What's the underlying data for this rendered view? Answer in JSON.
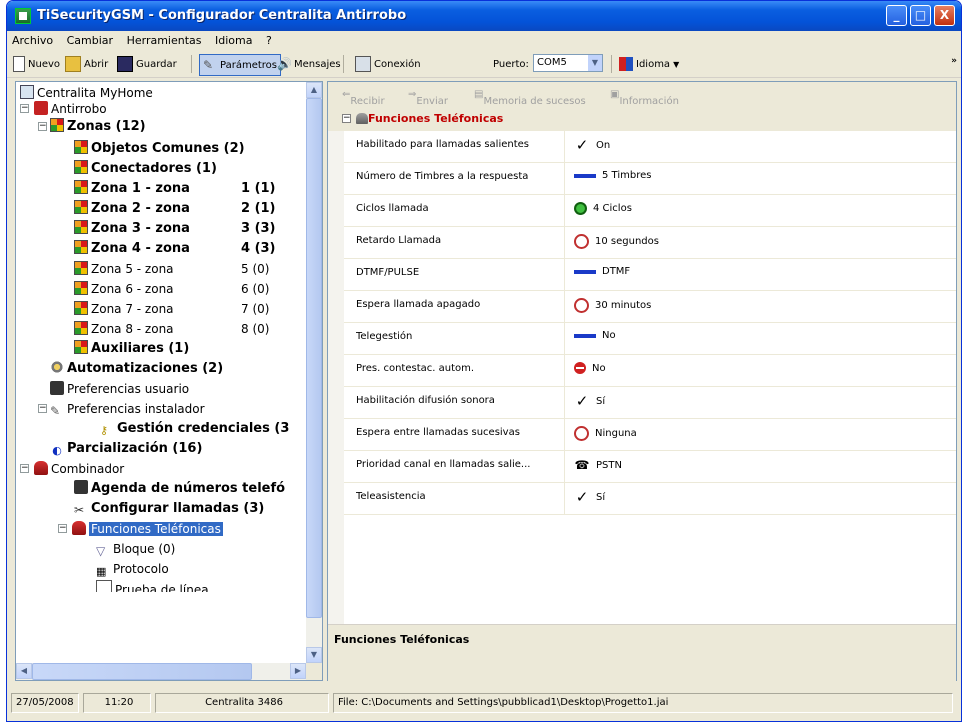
{
  "window": {
    "title": "TiSecurityGSM - Configurador Centralita Antirrobo",
    "controls": [
      "_",
      "□",
      "X"
    ]
  },
  "menu": [
    "Archivo",
    "Cambiar",
    "Herramientas",
    "Idioma",
    "?"
  ],
  "toolbar": {
    "nuevo": "Nuevo",
    "abrir": "Abrir",
    "guardar": "Guardar",
    "parametros": "Parámetros",
    "mensajes": "Mensajes",
    "conexion": "Conexión",
    "puerto_label": "Puerto:",
    "puerto_value": "COM5",
    "idioma": "Idioma",
    "more": "»"
  },
  "tree": {
    "root": "Centralita MyHome",
    "antirrobo": "Antirrobo",
    "zonas": "Zonas (12)",
    "objetos_comunes": "Objetos Comunes (2)",
    "conectadores": "Conectadores (1)",
    "zonas_list": [
      {
        "name": "Zona 1 - zona",
        "count": "1 (1)",
        "bold": true
      },
      {
        "name": "Zona 2 - zona",
        "count": "2 (1)",
        "bold": true
      },
      {
        "name": "Zona 3 - zona",
        "count": "3 (3)",
        "bold": true
      },
      {
        "name": "Zona 4 - zona",
        "count": "4 (3)",
        "bold": true
      },
      {
        "name": "Zona 5 - zona",
        "count": "5 (0)",
        "bold": false
      },
      {
        "name": "Zona 6 - zona",
        "count": "6 (0)",
        "bold": false
      },
      {
        "name": "Zona 7 - zona",
        "count": "7 (0)",
        "bold": false
      },
      {
        "name": "Zona 8 - zona",
        "count": "8 (0)",
        "bold": false
      }
    ],
    "auxiliares": "Auxiliares (1)",
    "automatizaciones": "Automatizaciones (2)",
    "pref_usuario": "Preferencias usuario",
    "pref_instalador": "Preferencias instalador",
    "gestion": "Gestión credenciales (3",
    "parcializacion": "Parcialización (16)",
    "combinador": "Combinador",
    "agenda": "Agenda de números telefó",
    "configurar": "Configurar llamadas (3)",
    "funciones": "Funciones Teléfonicas",
    "bloque": "Bloque (0)",
    "protocolo": "Protocolo",
    "prueba": "Prueba de línea"
  },
  "right_toolbar": {
    "recibir": "Recibir",
    "enviar": "Enviar",
    "memoria": "Memoria de sucesos",
    "informacion": "Información"
  },
  "grid": {
    "category": "Funciones Teléfonicas",
    "props": [
      {
        "name": "Habilitado para llamadas salientes",
        "value": "On",
        "icon": "check"
      },
      {
        "name": "Número de Timbres a la respuesta",
        "value": "5 Timbres",
        "icon": "bar"
      },
      {
        "name": "Ciclos llamada",
        "value": "4 Ciclos",
        "icon": "cycle"
      },
      {
        "name": "Retardo Llamada",
        "value": "10 segundos",
        "icon": "clock"
      },
      {
        "name": "DTMF/PULSE",
        "value": "DTMF",
        "icon": "bar"
      },
      {
        "name": "Espera llamada apagado",
        "value": "30 minutos",
        "icon": "clock"
      },
      {
        "name": "Telegestión",
        "value": "No",
        "icon": "bar"
      },
      {
        "name": "Pres. contestac. autom.",
        "value": "No",
        "icon": "stop"
      },
      {
        "name": "Habilitación difusión sonora",
        "value": "Sí",
        "icon": "check"
      },
      {
        "name": "Espera entre llamadas sucesivas",
        "value": "Ninguna",
        "icon": "clock"
      },
      {
        "name": "Prioridad canal en llamadas salie...",
        "value": "PSTN",
        "icon": "pstn"
      },
      {
        "name": "Teleasistencia",
        "value": "Sí",
        "icon": "check"
      }
    ]
  },
  "description": {
    "title": "Funciones Teléfonicas"
  },
  "status": {
    "date": "27/05/2008",
    "time": "11:20",
    "device": "Centralita 3486",
    "file": "File: C:\\Documents and Settings\\pubblicad1\\Desktop\\Progetto1.jai"
  }
}
